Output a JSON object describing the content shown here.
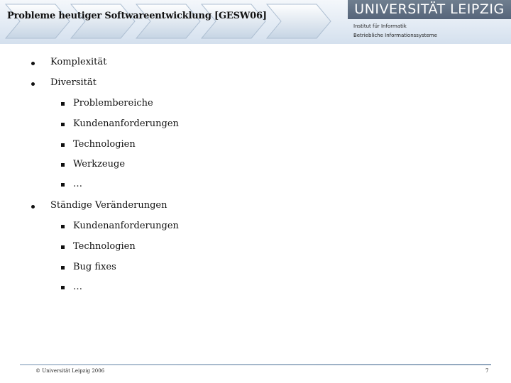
{
  "header": {
    "title": "Probleme heutiger Softwareentwicklung [GESW06]",
    "university": "UNIVERSITÄT LEIPZIG",
    "institute": "Institut für Informatik",
    "department": "Betriebliche Informationssysteme"
  },
  "content": {
    "items": [
      {
        "text": "Komplexität",
        "level": 1
      },
      {
        "text": "Diversität",
        "level": 1
      },
      {
        "text": "Problembereiche",
        "level": 2
      },
      {
        "text": "Kundenanforderungen",
        "level": 2
      },
      {
        "text": "Technologien",
        "level": 2
      },
      {
        "text": "Werkzeuge",
        "level": 2
      },
      {
        "text": "…",
        "level": 2
      },
      {
        "text": "Ständige Veränderungen",
        "level": 1
      },
      {
        "text": "Kundenanforderungen",
        "level": 2
      },
      {
        "text": "Technologien",
        "level": 2
      },
      {
        "text": "Bug fixes",
        "level": 2
      },
      {
        "text": "…",
        "level": 2
      }
    ]
  },
  "footer": {
    "copyright": "© Universität Leipzig 2006",
    "page_number": "7"
  }
}
